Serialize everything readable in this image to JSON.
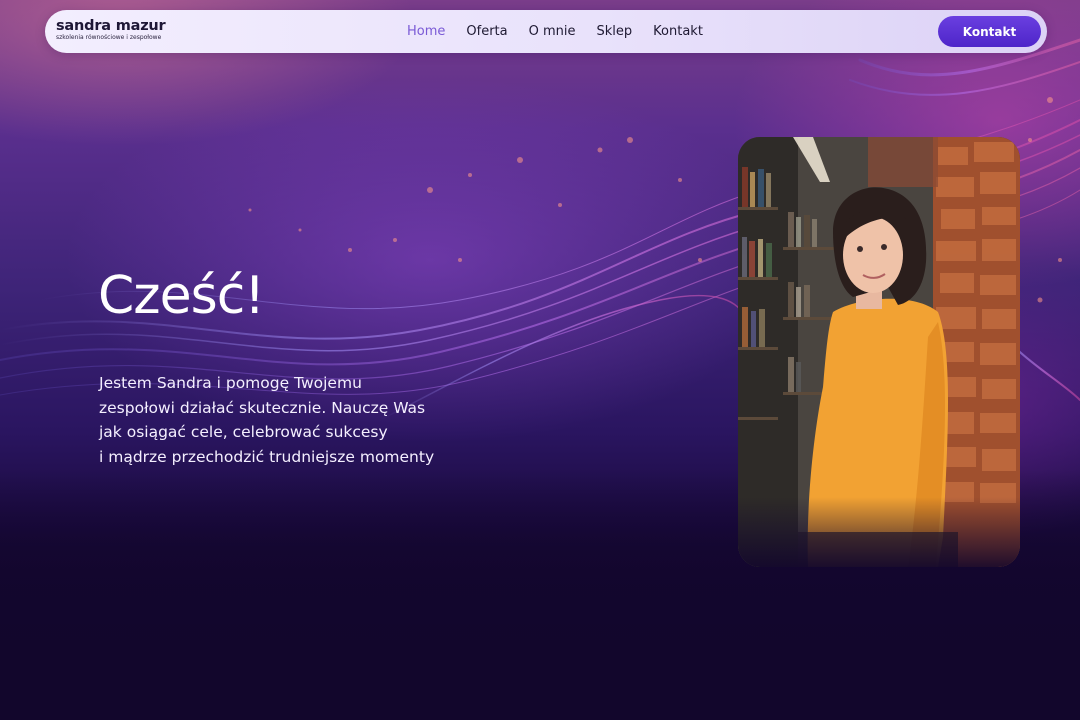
{
  "header": {
    "logo": {
      "title": "sandra mazur",
      "subtitle": "szkolenia równościowe i zespołowe"
    },
    "nav": [
      {
        "label": "Home",
        "active": true
      },
      {
        "label": "Oferta",
        "active": false
      },
      {
        "label": "O mnie",
        "active": false
      },
      {
        "label": "Sklep",
        "active": false
      },
      {
        "label": "Kontakt",
        "active": false
      }
    ],
    "cta_label": "Kontakt"
  },
  "hero": {
    "title": "Cześć!",
    "text_lines": [
      "Jestem Sandra i pomogę Twojemu",
      "zespołowi działać skutecznie. Nauczę Was",
      "jak osiągać cele, celebrować sukcesy",
      "i mądrze przechodzić trudniejsze momenty"
    ]
  },
  "colors": {
    "accent": "#5b32d6",
    "nav_active": "#7a5ad6",
    "background_dark": "#12062c",
    "header_bg": "#ece6fc"
  }
}
